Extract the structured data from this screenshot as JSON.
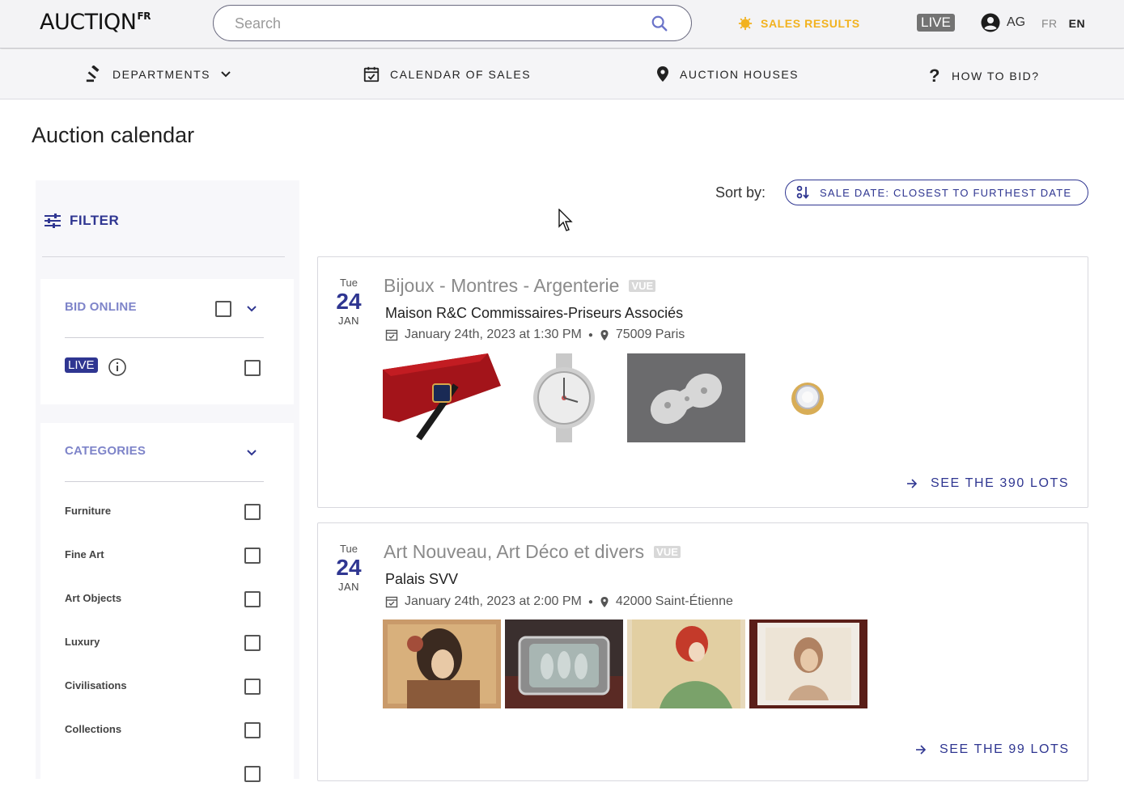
{
  "header": {
    "logo_main": "AUCTIQN",
    "logo_sup": "FR",
    "search_placeholder": "Search",
    "sales_results": "SALES RESULTS",
    "live": "LIVE",
    "user_initials": "AG",
    "lang_fr": "FR",
    "lang_en": "EN"
  },
  "nav": {
    "departments": "DEPARTMENTS",
    "calendar": "CALENDAR OF SALES",
    "houses": "AUCTION HOUSES",
    "howto": "HOW TO BID?"
  },
  "page": {
    "title": "Auction calendar",
    "sort_label": "Sort by:",
    "sort_value": "SALE DATE: CLOSEST TO FURTHEST DATE"
  },
  "sidebar": {
    "filter_label": "FILTER",
    "bid_online": "BID ONLINE",
    "live": "LIVE",
    "categories_label": "CATEGORIES",
    "categories": [
      {
        "label": "Furniture"
      },
      {
        "label": "Fine Art"
      },
      {
        "label": "Art Objects"
      },
      {
        "label": "Luxury"
      },
      {
        "label": "Civilisations"
      },
      {
        "label": "Collections"
      }
    ]
  },
  "sales": [
    {
      "dow": "Tue",
      "day": "24",
      "month": "JAN",
      "title": "Bijoux - Montres - Argenterie",
      "badge": "VUE",
      "house": "Maison R&C Commissaires-Priseurs Associés",
      "datetime": "January 24th, 2023 at 1:30 PM",
      "location": "75009 Paris",
      "see_lots": "SEE THE 390 LOTS"
    },
    {
      "dow": "Tue",
      "day": "24",
      "month": "JAN",
      "title": "Art Nouveau, Art Déco et divers",
      "badge": "VUE",
      "house": "Palais SVV",
      "datetime": "January 24th, 2023 at 2:00 PM",
      "location": "42000 Saint-Étienne",
      "see_lots": "SEE THE 99 LOTS"
    }
  ],
  "colors": {
    "brand": "#2f3691",
    "accent": "#f2b21e",
    "muted_title": "#8a8a8a"
  }
}
